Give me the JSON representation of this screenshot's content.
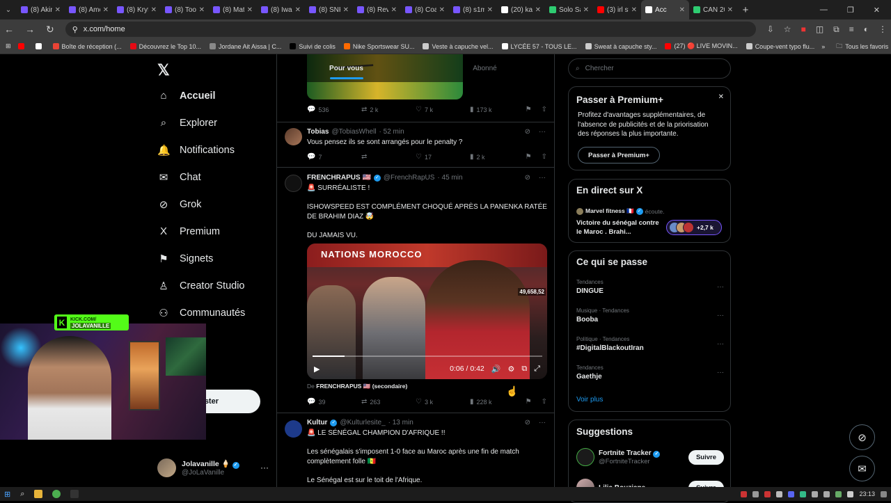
{
  "browser": {
    "tabs": [
      {
        "title": "(8) Akira",
        "color": "#7856ff"
      },
      {
        "title": "(8) Amo",
        "color": "#7856ff"
      },
      {
        "title": "(8) Kryfi",
        "color": "#7856ff"
      },
      {
        "title": "(8) Tools",
        "color": "#7856ff"
      },
      {
        "title": "(8) Mate",
        "color": "#7856ff"
      },
      {
        "title": "(8) Iwan",
        "color": "#7856ff"
      },
      {
        "title": "(8) SNK",
        "color": "#7856ff"
      },
      {
        "title": "(8) Revi",
        "color": "#7856ff"
      },
      {
        "title": "(8) Coa",
        "color": "#7856ff"
      },
      {
        "title": "(8) s1mi",
        "color": "#7856ff"
      },
      {
        "title": "(20) kai",
        "color": "#ffffff"
      },
      {
        "title": "Solo Sai",
        "color": "#2ecc71"
      },
      {
        "title": "(3) irl st",
        "color": "#ff0000"
      },
      {
        "title": "Acc",
        "color": "#ffffff",
        "active": true
      },
      {
        "title": "CAN 20",
        "color": "#2ecc71"
      }
    ],
    "url": "x.com/home",
    "bookmarks": [
      {
        "label": "",
        "color": "#ff0000"
      },
      {
        "label": "",
        "color": "#ffffff"
      },
      {
        "label": "Boîte de réception (...",
        "color": "#ea4335"
      },
      {
        "label": "Découvrez le Top 10...",
        "color": "#e50914"
      },
      {
        "label": "Jordane Ait Aissa | C...",
        "color": "#888888"
      },
      {
        "label": "Suivi de colis",
        "color": "#000000"
      },
      {
        "label": "Nike Sportswear SU...",
        "color": "#ff6a00"
      },
      {
        "label": "Veste à capuche vel...",
        "color": "#cccccc"
      },
      {
        "label": "LYCÉE 57 - TOUS LE...",
        "color": "#ffffff"
      },
      {
        "label": "Sweat à capuche sty...",
        "color": "#cccccc"
      },
      {
        "label": "(27) 🔴 LIVE MOVIN...",
        "color": "#ff0000"
      },
      {
        "label": "Coupe-vent typo flu...",
        "color": "#cccccc"
      }
    ],
    "all_bookmarks": "Tous les favoris"
  },
  "nav": {
    "items": [
      {
        "label": "Accueil",
        "icon": "home-icon",
        "glyph": "⌂",
        "active": true
      },
      {
        "label": "Explorer",
        "icon": "search-icon",
        "glyph": "⌕"
      },
      {
        "label": "Notifications",
        "icon": "bell-icon",
        "glyph": "🔔"
      },
      {
        "label": "Chat",
        "icon": "mail-icon",
        "glyph": "✉"
      },
      {
        "label": "Grok",
        "icon": "grok-icon",
        "glyph": "⊘"
      },
      {
        "label": "Premium",
        "icon": "x-premium-icon",
        "glyph": "X"
      },
      {
        "label": "Signets",
        "icon": "bookmark-icon",
        "glyph": "⚑"
      },
      {
        "label": "Creator Studio",
        "icon": "creator-icon",
        "glyph": "♙"
      },
      {
        "label": "Communautés",
        "icon": "communities-icon",
        "glyph": "⚇"
      }
    ],
    "post_label": "ster",
    "profile": {
      "name": "Jolavanille 🍦",
      "handle": "@JoLaVanille"
    }
  },
  "feed": {
    "tabs": [
      "Pour vous",
      "Abonné"
    ],
    "first_actions": {
      "replies": "536",
      "reposts": "2 k",
      "likes": "7 k",
      "views": "173 k"
    },
    "tweets": [
      {
        "name": "Tobias",
        "handle": "@TobiasWhell",
        "time": "· 52 min",
        "text": "Vous pensez ils se sont arrangés pour le penalty ?",
        "replies": "7",
        "reposts": "",
        "likes": "17",
        "views": "2 k"
      },
      {
        "name": "FRENCHRAPUS 🇺🇸",
        "handle": "@FrenchRapUS",
        "time": "· 45 min",
        "lines": [
          "🚨 SURRÉALISTE !",
          "",
          "ISHOWSPEED EST COMPLÉMENT CHOQUÉ APRÈS LA PANENKA RATÉE DE BRAHIM DIAZ 🤯",
          "",
          "DU JAMAIS VU."
        ],
        "video": {
          "banner": "NATIONS MOROCCO",
          "counter": "49,658,52",
          "time": "0:06 / 0:42",
          "progress_pct": 14
        },
        "source_prefix": "De",
        "source_name": "FRENCHRAPUS 🇺🇸 (secondaire)",
        "replies": "39",
        "reposts": "263",
        "likes": "3 k",
        "views": "228 k"
      },
      {
        "name": "Kultur",
        "handle": "@Kulturlesite_",
        "time": "· 13 min",
        "lines": [
          "🚨 LE SÉNÉGAL CHAMPION D'AFRIQUE !!",
          "",
          "Les sénégalais s'imposent 1-0 face au Maroc après une fin de match complètement folle 🇸🇳",
          "",
          "Le Sénégal est sur le toit de l'Afrique."
        ]
      }
    ]
  },
  "right": {
    "search_placeholder": "Chercher",
    "premium": {
      "title": "Passer à Premium+",
      "desc": "Profitez d'avantages supplémentaires, de l'absence de publicités et de la priorisation des réponses la plus importante.",
      "button": "Passer à Premium+"
    },
    "live": {
      "title": "En direct sur X",
      "host": "Marvel fitness 🇫🇷",
      "host_suffix": "écoute.",
      "space_title": "Victoire du sénégal contre le Maroc . Brahi...",
      "count": "+2,7 k"
    },
    "happening": {
      "title": "Ce qui se passe",
      "trends": [
        {
          "category": "Tendances",
          "name": "DINGUE"
        },
        {
          "category": "Musique · Tendances",
          "name": "Booba"
        },
        {
          "category": "Politique · Tendances",
          "name": "#DigitalBlackoutIran"
        },
        {
          "category": "Tendances",
          "name": "Gaethje"
        }
      ],
      "see_more": "Voir plus"
    },
    "suggestions": {
      "title": "Suggestions",
      "items": [
        {
          "name": "Fortnite Tracker",
          "handle": "@FortniteTracker",
          "button": "Suivre"
        },
        {
          "name": "Lilia Bouziane",
          "handle": "",
          "button": "Suivre"
        }
      ]
    }
  },
  "webcam": {
    "kick_line1": "KICK.COM/",
    "kick_line2": "JOLAVANILLE"
  },
  "taskbar": {
    "time": "23:13"
  }
}
